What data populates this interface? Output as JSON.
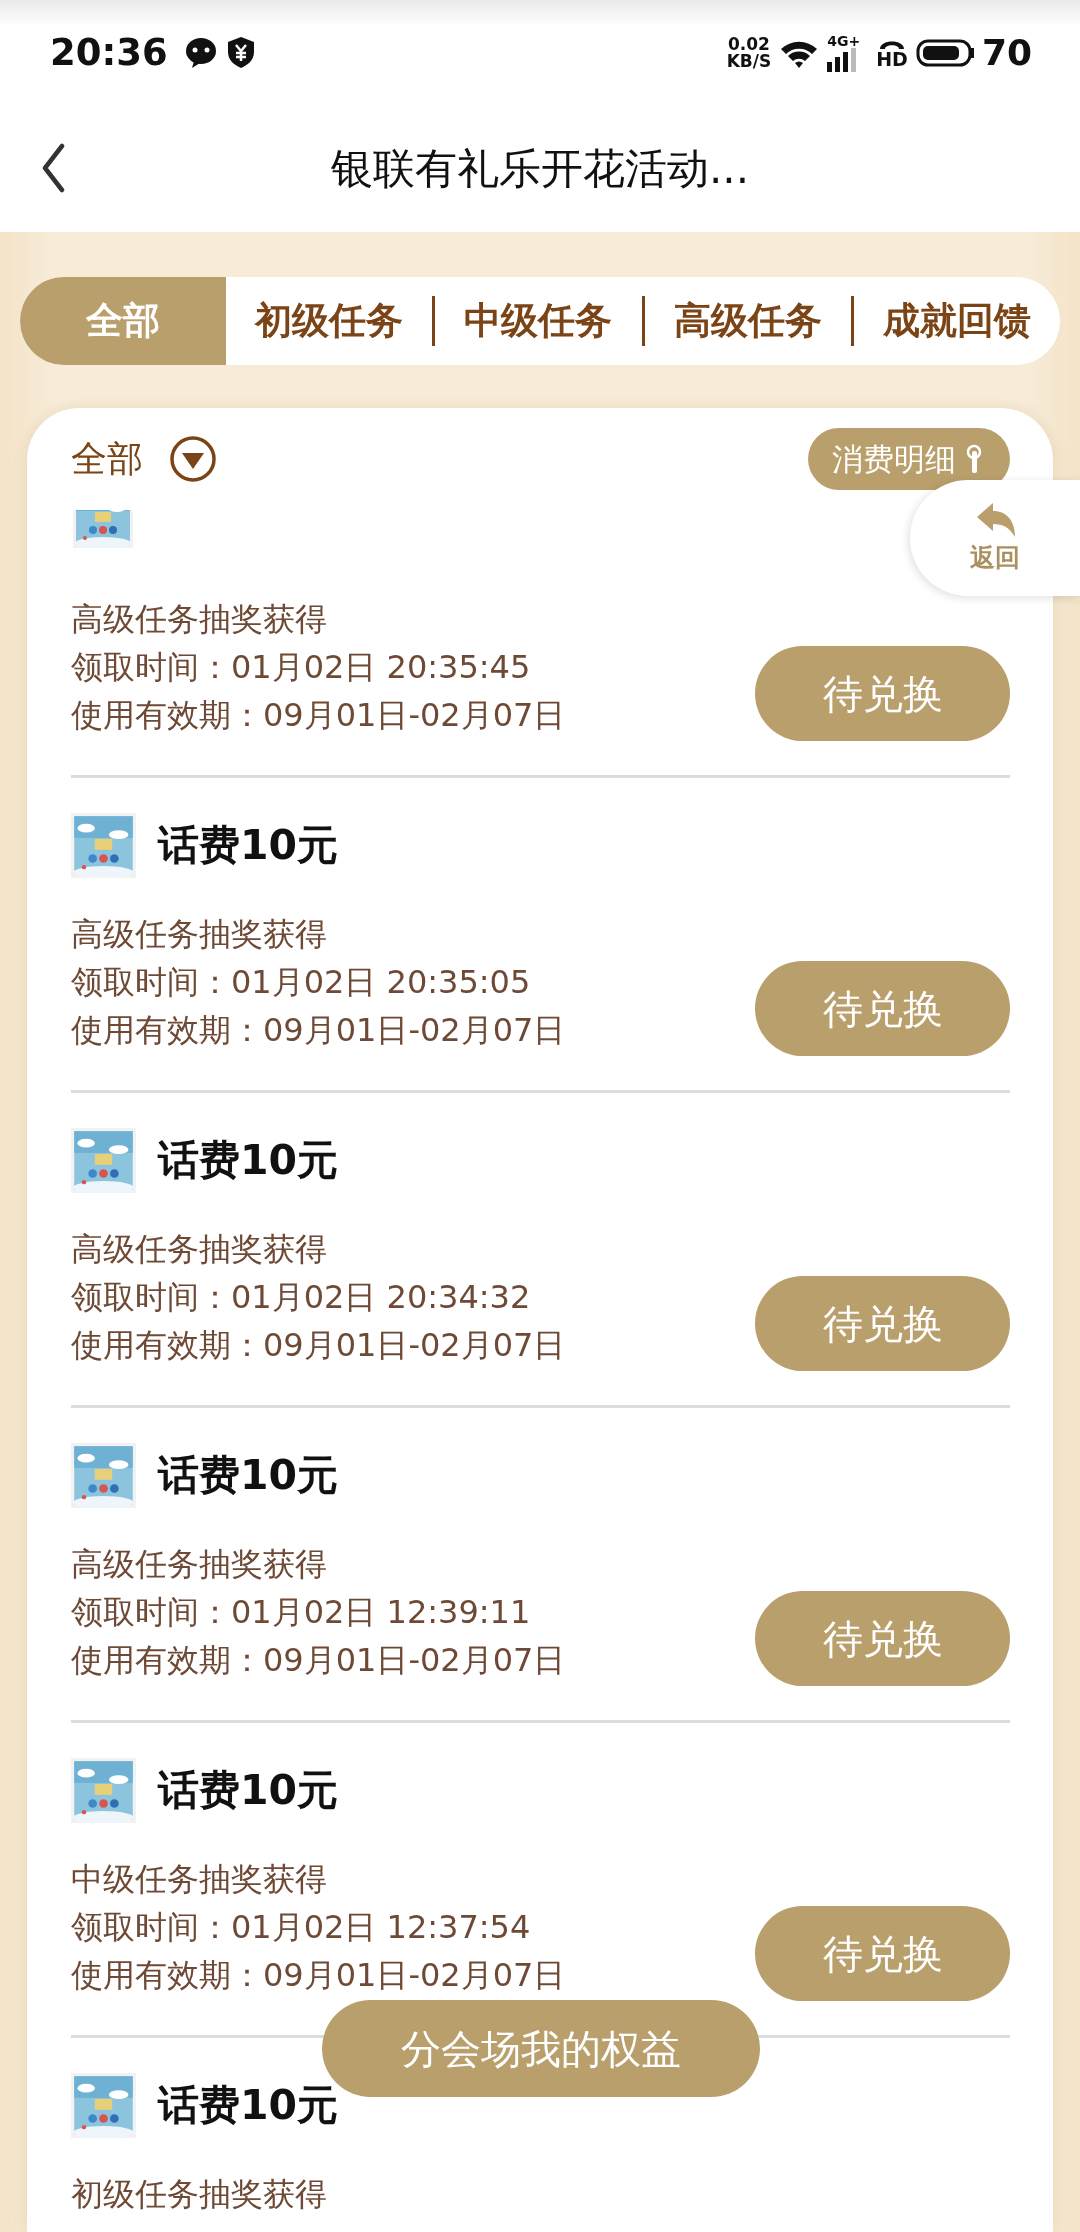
{
  "status_bar": {
    "time": "20:36",
    "speed_value": "0.02",
    "speed_unit": "KB/S",
    "network": "4G+",
    "hd": "HD",
    "battery": "70"
  },
  "header": {
    "title": "银联有礼乐开花活动..."
  },
  "tabs": [
    {
      "label": "全部",
      "selected": true
    },
    {
      "label": "初级任务",
      "selected": false
    },
    {
      "label": "中级任务",
      "selected": false
    },
    {
      "label": "高级任务",
      "selected": false
    },
    {
      "label": "成就回馈",
      "selected": false
    }
  ],
  "filter": {
    "label": "全部"
  },
  "detail_button": "消费明细",
  "back_tab": "返回",
  "rewards": [
    {
      "kind": "partial",
      "source": "高级任务抽奖获得",
      "claim_time": "领取时间：01月02日 20:35:45",
      "validity": "使用有效期：09月01日-02月07日",
      "button": "待兑换"
    },
    {
      "kind": "full",
      "title": "话费10元",
      "source": "高级任务抽奖获得",
      "claim_time": "领取时间：01月02日 20:35:05",
      "validity": "使用有效期：09月01日-02月07日",
      "button": "待兑换"
    },
    {
      "kind": "full",
      "title": "话费10元",
      "source": "高级任务抽奖获得",
      "claim_time": "领取时间：01月02日 20:34:32",
      "validity": "使用有效期：09月01日-02月07日",
      "button": "待兑换"
    },
    {
      "kind": "full",
      "title": "话费10元",
      "source": "高级任务抽奖获得",
      "claim_time": "领取时间：01月02日 12:39:11",
      "validity": "使用有效期：09月01日-02月07日",
      "button": "待兑换"
    },
    {
      "kind": "full",
      "title": "话费10元",
      "source": "中级任务抽奖获得",
      "claim_time": "领取时间：01月02日 12:37:54",
      "validity": "使用有效期：09月01日-02月07日",
      "button": "待兑换"
    },
    {
      "kind": "cut",
      "title": "话费10元",
      "source": "初级任务抽奖获得"
    }
  ],
  "bottom_button": "分会场我的权益"
}
